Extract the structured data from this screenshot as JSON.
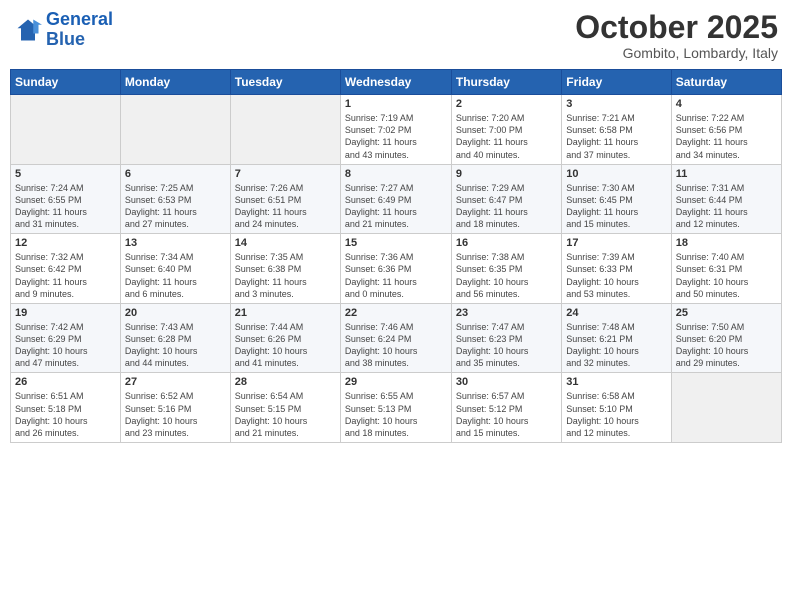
{
  "logo": {
    "line1": "General",
    "line2": "Blue"
  },
  "header": {
    "month": "October 2025",
    "location": "Gombito, Lombardy, Italy"
  },
  "weekdays": [
    "Sunday",
    "Monday",
    "Tuesday",
    "Wednesday",
    "Thursday",
    "Friday",
    "Saturday"
  ],
  "weeks": [
    [
      {
        "day": "",
        "info": ""
      },
      {
        "day": "",
        "info": ""
      },
      {
        "day": "",
        "info": ""
      },
      {
        "day": "1",
        "info": "Sunrise: 7:19 AM\nSunset: 7:02 PM\nDaylight: 11 hours\nand 43 minutes."
      },
      {
        "day": "2",
        "info": "Sunrise: 7:20 AM\nSunset: 7:00 PM\nDaylight: 11 hours\nand 40 minutes."
      },
      {
        "day": "3",
        "info": "Sunrise: 7:21 AM\nSunset: 6:58 PM\nDaylight: 11 hours\nand 37 minutes."
      },
      {
        "day": "4",
        "info": "Sunrise: 7:22 AM\nSunset: 6:56 PM\nDaylight: 11 hours\nand 34 minutes."
      }
    ],
    [
      {
        "day": "5",
        "info": "Sunrise: 7:24 AM\nSunset: 6:55 PM\nDaylight: 11 hours\nand 31 minutes."
      },
      {
        "day": "6",
        "info": "Sunrise: 7:25 AM\nSunset: 6:53 PM\nDaylight: 11 hours\nand 27 minutes."
      },
      {
        "day": "7",
        "info": "Sunrise: 7:26 AM\nSunset: 6:51 PM\nDaylight: 11 hours\nand 24 minutes."
      },
      {
        "day": "8",
        "info": "Sunrise: 7:27 AM\nSunset: 6:49 PM\nDaylight: 11 hours\nand 21 minutes."
      },
      {
        "day": "9",
        "info": "Sunrise: 7:29 AM\nSunset: 6:47 PM\nDaylight: 11 hours\nand 18 minutes."
      },
      {
        "day": "10",
        "info": "Sunrise: 7:30 AM\nSunset: 6:45 PM\nDaylight: 11 hours\nand 15 minutes."
      },
      {
        "day": "11",
        "info": "Sunrise: 7:31 AM\nSunset: 6:44 PM\nDaylight: 11 hours\nand 12 minutes."
      }
    ],
    [
      {
        "day": "12",
        "info": "Sunrise: 7:32 AM\nSunset: 6:42 PM\nDaylight: 11 hours\nand 9 minutes."
      },
      {
        "day": "13",
        "info": "Sunrise: 7:34 AM\nSunset: 6:40 PM\nDaylight: 11 hours\nand 6 minutes."
      },
      {
        "day": "14",
        "info": "Sunrise: 7:35 AM\nSunset: 6:38 PM\nDaylight: 11 hours\nand 3 minutes."
      },
      {
        "day": "15",
        "info": "Sunrise: 7:36 AM\nSunset: 6:36 PM\nDaylight: 11 hours\nand 0 minutes."
      },
      {
        "day": "16",
        "info": "Sunrise: 7:38 AM\nSunset: 6:35 PM\nDaylight: 10 hours\nand 56 minutes."
      },
      {
        "day": "17",
        "info": "Sunrise: 7:39 AM\nSunset: 6:33 PM\nDaylight: 10 hours\nand 53 minutes."
      },
      {
        "day": "18",
        "info": "Sunrise: 7:40 AM\nSunset: 6:31 PM\nDaylight: 10 hours\nand 50 minutes."
      }
    ],
    [
      {
        "day": "19",
        "info": "Sunrise: 7:42 AM\nSunset: 6:29 PM\nDaylight: 10 hours\nand 47 minutes."
      },
      {
        "day": "20",
        "info": "Sunrise: 7:43 AM\nSunset: 6:28 PM\nDaylight: 10 hours\nand 44 minutes."
      },
      {
        "day": "21",
        "info": "Sunrise: 7:44 AM\nSunset: 6:26 PM\nDaylight: 10 hours\nand 41 minutes."
      },
      {
        "day": "22",
        "info": "Sunrise: 7:46 AM\nSunset: 6:24 PM\nDaylight: 10 hours\nand 38 minutes."
      },
      {
        "day": "23",
        "info": "Sunrise: 7:47 AM\nSunset: 6:23 PM\nDaylight: 10 hours\nand 35 minutes."
      },
      {
        "day": "24",
        "info": "Sunrise: 7:48 AM\nSunset: 6:21 PM\nDaylight: 10 hours\nand 32 minutes."
      },
      {
        "day": "25",
        "info": "Sunrise: 7:50 AM\nSunset: 6:20 PM\nDaylight: 10 hours\nand 29 minutes."
      }
    ],
    [
      {
        "day": "26",
        "info": "Sunrise: 6:51 AM\nSunset: 5:18 PM\nDaylight: 10 hours\nand 26 minutes."
      },
      {
        "day": "27",
        "info": "Sunrise: 6:52 AM\nSunset: 5:16 PM\nDaylight: 10 hours\nand 23 minutes."
      },
      {
        "day": "28",
        "info": "Sunrise: 6:54 AM\nSunset: 5:15 PM\nDaylight: 10 hours\nand 21 minutes."
      },
      {
        "day": "29",
        "info": "Sunrise: 6:55 AM\nSunset: 5:13 PM\nDaylight: 10 hours\nand 18 minutes."
      },
      {
        "day": "30",
        "info": "Sunrise: 6:57 AM\nSunset: 5:12 PM\nDaylight: 10 hours\nand 15 minutes."
      },
      {
        "day": "31",
        "info": "Sunrise: 6:58 AM\nSunset: 5:10 PM\nDaylight: 10 hours\nand 12 minutes."
      },
      {
        "day": "",
        "info": ""
      }
    ]
  ]
}
